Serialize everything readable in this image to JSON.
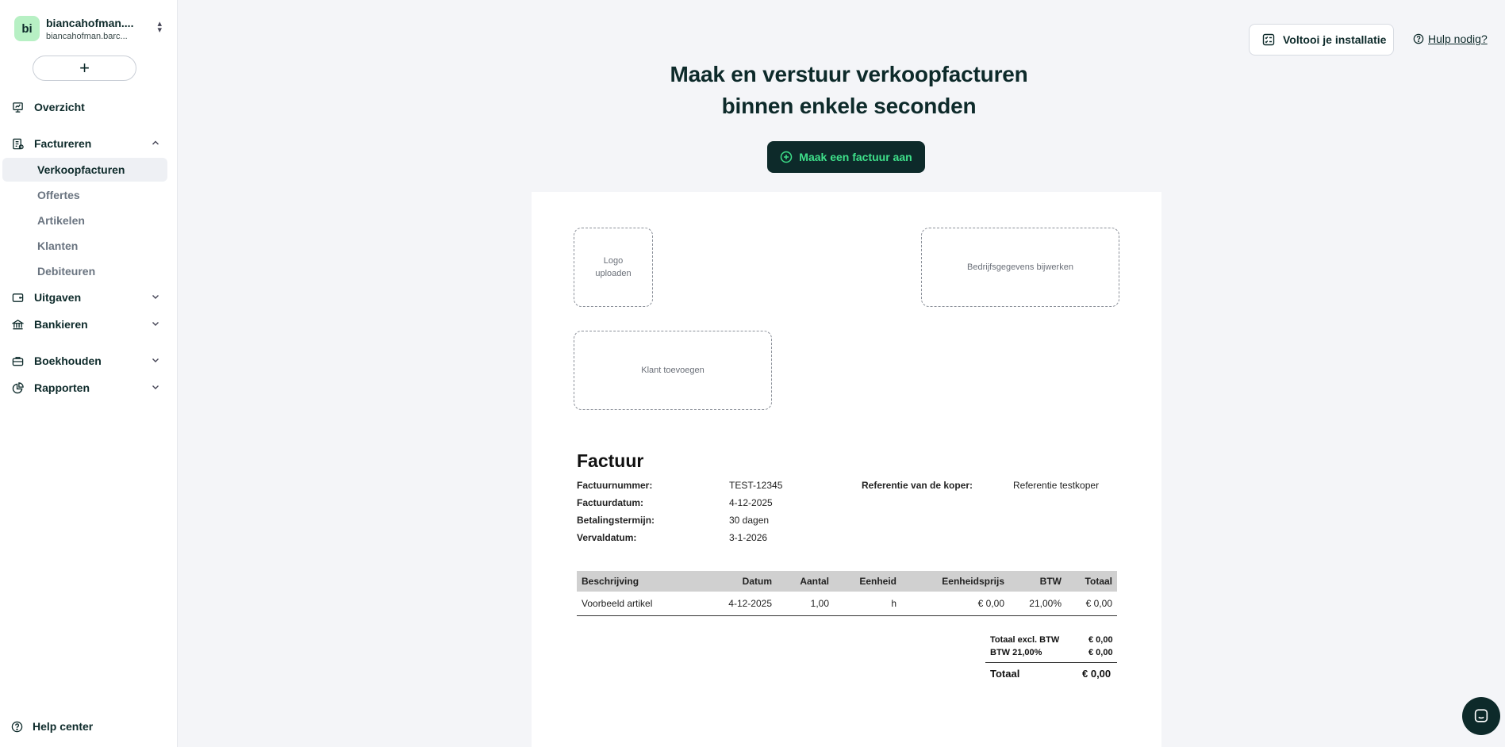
{
  "org": {
    "initials": "bi",
    "name": "biancahofman....",
    "sub": "biancahofman.barc..."
  },
  "sidebar": {
    "add_label": "+",
    "overview": "Overzicht",
    "invoicing": "Factureren",
    "invoicing_items": [
      "Verkoopfacturen",
      "Offertes",
      "Artikelen",
      "Klanten",
      "Debiteuren"
    ],
    "expenses": "Uitgaven",
    "banking": "Bankieren",
    "bookkeeping": "Boekhouden",
    "reports": "Rapporten",
    "help_center": "Help center"
  },
  "header": {
    "setup_label": "Voltooi je installatie",
    "help_label": "Hulp nodig?",
    "headline_line1": "Maak en verstuur verkoopfacturen",
    "headline_line2": "binnen enkele seconden",
    "create_label": "Maak een factuur aan"
  },
  "invoice": {
    "logo_line1": "Logo",
    "logo_line2": "uploaden",
    "company_label": "Bedrijfsgegevens bijwerken",
    "client_label": "Klant toevoegen",
    "title": "Factuur",
    "fields": {
      "number_label": "Factuurnummer:",
      "number_value": "TEST-12345",
      "date_label": "Factuurdatum:",
      "date_value": "4-12-2025",
      "term_label": "Betalingstermijn:",
      "term_value": "30 dagen",
      "due_label": "Vervaldatum:",
      "due_value": "3-1-2026",
      "ref_label": "Referentie van de koper:",
      "ref_value": "Referentie testkoper"
    },
    "table": {
      "headers": [
        "Beschrijving",
        "Datum",
        "Aantal",
        "Eenheid",
        "Eenheidsprijs",
        "BTW",
        "Totaal"
      ],
      "rows": [
        [
          "Voorbeeld artikel",
          "4-12-2025",
          "1,00",
          "h",
          "€ 0,00",
          "21,00%",
          "€ 0,00"
        ]
      ]
    },
    "totals": {
      "excl_label": "Totaal excl. BTW",
      "excl_value": "€ 0,00",
      "vat_label": "BTW 21,00%",
      "vat_value": "€ 0,00",
      "total_label": "Totaal",
      "total_value": "€ 0,00"
    }
  },
  "colors": {
    "brand_dark": "#0d2a2a",
    "accent_green": "#3ee08a",
    "avatar_bg": "#b7f0c4"
  }
}
